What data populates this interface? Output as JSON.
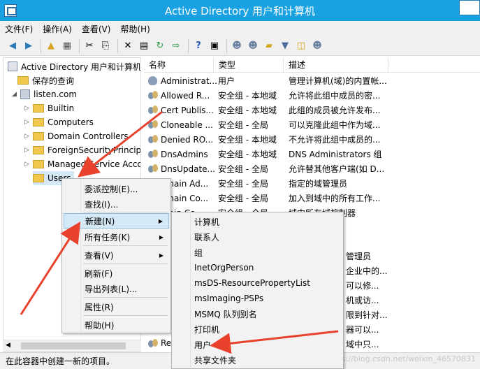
{
  "window": {
    "title": "Active Directory 用户和计算机"
  },
  "menu": [
    "文件(F)",
    "操作(A)",
    "查看(V)",
    "帮助(H)"
  ],
  "toolbar_icons": [
    "back-icon",
    "forward-icon",
    "up-folder-icon",
    "show-hide-tree-icon",
    "cut-icon",
    "copy-icon",
    "delete-icon",
    "properties-icon",
    "refresh-icon",
    "export-icon",
    "help-icon",
    "view-icon",
    "new-user-icon",
    "new-group-icon",
    "new-ou-icon",
    "filter-icon",
    "find-icon",
    "add-to-group-icon"
  ],
  "tree": {
    "root": "Active Directory 用户和计算机",
    "saved_queries": "保存的查询",
    "domain": "listen.com",
    "children": [
      "Builtin",
      "Computers",
      "Domain Controllers",
      "ForeignSecurityPrincipa",
      "Managed Service Acco",
      "Users"
    ]
  },
  "columns": {
    "name": "名称",
    "type": "类型",
    "desc": "描述"
  },
  "rows": [
    {
      "name": "Administrat...",
      "type": "用户",
      "desc": "管理计算机(域)的内置帐...",
      "icon": "user"
    },
    {
      "name": "Allowed R...",
      "type": "安全组 - 本地域",
      "desc": "允许将此组中成员的密...",
      "icon": "group"
    },
    {
      "name": "Cert Publis...",
      "type": "安全组 - 本地域",
      "desc": "此组的成员被允许发布...",
      "icon": "group"
    },
    {
      "name": "Cloneable ...",
      "type": "安全组 - 全局",
      "desc": "可以克隆此组中作为域...",
      "icon": "group"
    },
    {
      "name": "Denied RO...",
      "type": "安全组 - 本地域",
      "desc": "不允许将此组中成员的...",
      "icon": "group"
    },
    {
      "name": "DnsAdmins",
      "type": "安全组 - 本地域",
      "desc": "DNS Administrators 组",
      "icon": "group"
    },
    {
      "name": "DnsUpdate...",
      "type": "安全组 - 全局",
      "desc": "允许替其他客户端(如 D...",
      "icon": "group"
    },
    {
      "name": "omain Ad...",
      "type": "安全组 - 全局",
      "desc": "指定的域管理员",
      "icon": "group"
    },
    {
      "name": "omain Co...",
      "type": "安全组 - 全局",
      "desc": "加入到域中的所有工作...",
      "icon": "group"
    },
    {
      "name": "main Co...",
      "type": "安全组 - 全局",
      "desc": "域中所有域控制器",
      "icon": "group"
    }
  ],
  "partial_desc": [
    "管理员",
    "企业中的...",
    "可以修...",
    "机或访...",
    "限到针对...",
    "器可以...",
    "域中只..."
  ],
  "partial_name_last": "Re",
  "context_menu": {
    "items": [
      "委派控制(E)...",
      "查找(I)...",
      "新建(N)",
      "所有任务(K)",
      "查看(V)",
      "刷新(F)",
      "导出列表(L)...",
      "属性(R)",
      "帮助(H)"
    ]
  },
  "submenu": {
    "items": [
      "计算机",
      "联系人",
      "组",
      "InetOrgPerson",
      "msDS-ResourcePropertyList",
      "msImaging-PSPs",
      "MSMQ 队列别名",
      "打印机",
      "用户",
      "共享文件夹"
    ]
  },
  "status": "在此容器中创建一新的项目。",
  "watermark": "https://blog.csdn.net/weixin_46570831",
  "colors": {
    "titlebar": "#1aa1e2",
    "arrow": "#e8412c",
    "highlight": "#d5e8f6"
  }
}
